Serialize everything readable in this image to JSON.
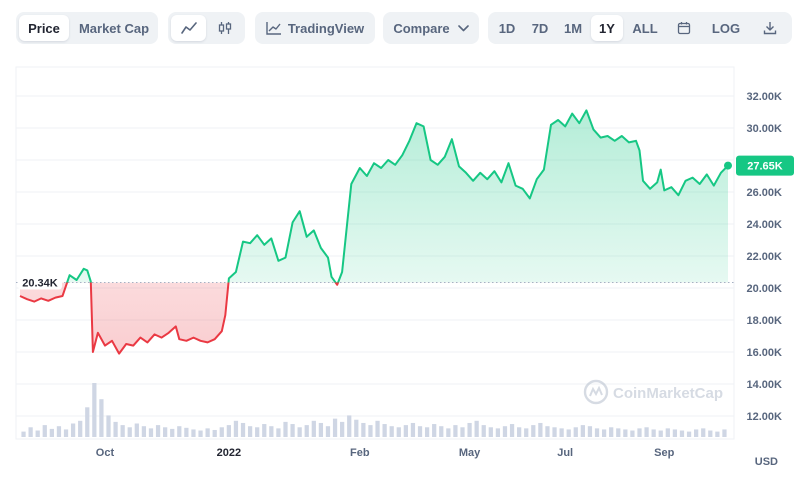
{
  "toolbar": {
    "mode_tabs": [
      {
        "label": "Price",
        "active": true
      },
      {
        "label": "Market Cap",
        "active": false
      }
    ],
    "chart_style": {
      "line_icon": "line-chart-icon",
      "candle_icon": "candlestick-icon",
      "active": "line"
    },
    "tradingview_label": "TradingView",
    "tradingview_icon": "tradingview-chart-icon",
    "compare_label": "Compare",
    "compare_icon": "chevron-down-icon",
    "ranges": [
      {
        "label": "1D",
        "active": false
      },
      {
        "label": "7D",
        "active": false
      },
      {
        "label": "1M",
        "active": false
      },
      {
        "label": "1Y",
        "active": true
      },
      {
        "label": "ALL",
        "active": false
      }
    ],
    "calendar_icon": "calendar-icon",
    "log_label": "LOG",
    "download_icon": "download-icon"
  },
  "watermark": "CoinMarketCap",
  "watermark_icon": "coinmarketcap-logo-icon",
  "colors": {
    "up": "#16c784",
    "down": "#ea3943",
    "grid": "#eff2f5",
    "baseline": "#a6b0c3",
    "volume": "#cfd6e4"
  },
  "chart_data": {
    "type": "area",
    "currency_label": "USD",
    "baseline": {
      "value": 20340,
      "label": "20.34K"
    },
    "current": {
      "value": 27650,
      "label": "27.65K"
    },
    "y_ticks": [
      {
        "value": 12000,
        "label": "12.00K"
      },
      {
        "value": 14000,
        "label": "14.00K"
      },
      {
        "value": 16000,
        "label": "16.00K"
      },
      {
        "value": 18000,
        "label": "18.00K"
      },
      {
        "value": 20000,
        "label": "20.00K"
      },
      {
        "value": 22000,
        "label": "22.00K"
      },
      {
        "value": 24000,
        "label": "24.00K"
      },
      {
        "value": 26000,
        "label": "26.00K"
      },
      {
        "value": 28000,
        "label": "28.00K"
      },
      {
        "value": 30000,
        "label": "30.00K"
      },
      {
        "value": 32000,
        "label": "32.00K"
      }
    ],
    "ylim": [
      11000,
      33500
    ],
    "x_ticks": [
      {
        "t": 0.12,
        "label": "Oct",
        "bold": false
      },
      {
        "t": 0.295,
        "label": "2022",
        "bold": true
      },
      {
        "t": 0.48,
        "label": "Feb",
        "bold": false
      },
      {
        "t": 0.635,
        "label": "May",
        "bold": false
      },
      {
        "t": 0.77,
        "label": "Jul",
        "bold": false
      },
      {
        "t": 0.91,
        "label": "Sep",
        "bold": false
      }
    ],
    "price_series": [
      {
        "t": 0.0,
        "v": 19500
      },
      {
        "t": 0.01,
        "v": 19300
      },
      {
        "t": 0.02,
        "v": 19150
      },
      {
        "t": 0.03,
        "v": 19350
      },
      {
        "t": 0.04,
        "v": 19200
      },
      {
        "t": 0.05,
        "v": 19400
      },
      {
        "t": 0.06,
        "v": 19500
      },
      {
        "t": 0.07,
        "v": 20800
      },
      {
        "t": 0.08,
        "v": 20500
      },
      {
        "t": 0.09,
        "v": 21200
      },
      {
        "t": 0.095,
        "v": 21100
      },
      {
        "t": 0.1,
        "v": 20400
      },
      {
        "t": 0.103,
        "v": 16000
      },
      {
        "t": 0.11,
        "v": 17200
      },
      {
        "t": 0.12,
        "v": 16400
      },
      {
        "t": 0.13,
        "v": 16700
      },
      {
        "t": 0.14,
        "v": 15900
      },
      {
        "t": 0.15,
        "v": 16500
      },
      {
        "t": 0.16,
        "v": 16400
      },
      {
        "t": 0.17,
        "v": 16900
      },
      {
        "t": 0.18,
        "v": 16600
      },
      {
        "t": 0.19,
        "v": 17100
      },
      {
        "t": 0.2,
        "v": 16900
      },
      {
        "t": 0.21,
        "v": 17200
      },
      {
        "t": 0.22,
        "v": 17600
      },
      {
        "t": 0.225,
        "v": 16800
      },
      {
        "t": 0.235,
        "v": 16700
      },
      {
        "t": 0.245,
        "v": 16900
      },
      {
        "t": 0.255,
        "v": 16700
      },
      {
        "t": 0.265,
        "v": 16600
      },
      {
        "t": 0.275,
        "v": 16800
      },
      {
        "t": 0.285,
        "v": 17300
      },
      {
        "t": 0.29,
        "v": 18300
      },
      {
        "t": 0.295,
        "v": 20600
      },
      {
        "t": 0.305,
        "v": 21000
      },
      {
        "t": 0.315,
        "v": 22900
      },
      {
        "t": 0.325,
        "v": 22800
      },
      {
        "t": 0.335,
        "v": 23300
      },
      {
        "t": 0.345,
        "v": 22700
      },
      {
        "t": 0.355,
        "v": 23100
      },
      {
        "t": 0.365,
        "v": 21700
      },
      {
        "t": 0.375,
        "v": 21900
      },
      {
        "t": 0.385,
        "v": 24100
      },
      {
        "t": 0.395,
        "v": 24800
      },
      {
        "t": 0.405,
        "v": 23200
      },
      {
        "t": 0.415,
        "v": 23600
      },
      {
        "t": 0.425,
        "v": 22500
      },
      {
        "t": 0.435,
        "v": 21900
      },
      {
        "t": 0.44,
        "v": 20700
      },
      {
        "t": 0.448,
        "v": 20200
      },
      {
        "t": 0.455,
        "v": 21000
      },
      {
        "t": 0.462,
        "v": 24000
      },
      {
        "t": 0.468,
        "v": 26500
      },
      {
        "t": 0.48,
        "v": 27500
      },
      {
        "t": 0.49,
        "v": 27000
      },
      {
        "t": 0.5,
        "v": 27800
      },
      {
        "t": 0.51,
        "v": 27500
      },
      {
        "t": 0.52,
        "v": 28000
      },
      {
        "t": 0.53,
        "v": 27700
      },
      {
        "t": 0.54,
        "v": 28300
      },
      {
        "t": 0.55,
        "v": 29200
      },
      {
        "t": 0.56,
        "v": 30300
      },
      {
        "t": 0.57,
        "v": 30100
      },
      {
        "t": 0.58,
        "v": 28000
      },
      {
        "t": 0.59,
        "v": 27700
      },
      {
        "t": 0.6,
        "v": 28200
      },
      {
        "t": 0.61,
        "v": 29300
      },
      {
        "t": 0.62,
        "v": 27600
      },
      {
        "t": 0.63,
        "v": 27200
      },
      {
        "t": 0.64,
        "v": 26700
      },
      {
        "t": 0.65,
        "v": 27200
      },
      {
        "t": 0.66,
        "v": 26800
      },
      {
        "t": 0.67,
        "v": 27300
      },
      {
        "t": 0.68,
        "v": 26600
      },
      {
        "t": 0.69,
        "v": 27800
      },
      {
        "t": 0.7,
        "v": 26400
      },
      {
        "t": 0.71,
        "v": 26200
      },
      {
        "t": 0.72,
        "v": 25600
      },
      {
        "t": 0.73,
        "v": 26800
      },
      {
        "t": 0.74,
        "v": 27400
      },
      {
        "t": 0.75,
        "v": 30200
      },
      {
        "t": 0.76,
        "v": 30500
      },
      {
        "t": 0.77,
        "v": 30100
      },
      {
        "t": 0.78,
        "v": 30900
      },
      {
        "t": 0.79,
        "v": 30300
      },
      {
        "t": 0.8,
        "v": 31100
      },
      {
        "t": 0.81,
        "v": 29900
      },
      {
        "t": 0.82,
        "v": 29400
      },
      {
        "t": 0.83,
        "v": 29500
      },
      {
        "t": 0.84,
        "v": 29200
      },
      {
        "t": 0.85,
        "v": 29500
      },
      {
        "t": 0.86,
        "v": 29100
      },
      {
        "t": 0.87,
        "v": 29200
      },
      {
        "t": 0.875,
        "v": 28600
      },
      {
        "t": 0.88,
        "v": 26700
      },
      {
        "t": 0.89,
        "v": 26200
      },
      {
        "t": 0.9,
        "v": 26600
      },
      {
        "t": 0.905,
        "v": 27400
      },
      {
        "t": 0.91,
        "v": 26100
      },
      {
        "t": 0.92,
        "v": 26300
      },
      {
        "t": 0.93,
        "v": 25800
      },
      {
        "t": 0.94,
        "v": 26700
      },
      {
        "t": 0.95,
        "v": 26900
      },
      {
        "t": 0.96,
        "v": 26500
      },
      {
        "t": 0.97,
        "v": 27100
      },
      {
        "t": 0.98,
        "v": 26400
      },
      {
        "t": 0.99,
        "v": 27200
      },
      {
        "t": 1.0,
        "v": 27650
      }
    ],
    "volume_series": [
      0.1,
      0.18,
      0.12,
      0.22,
      0.15,
      0.2,
      0.14,
      0.25,
      0.3,
      0.55,
      1.0,
      0.7,
      0.4,
      0.28,
      0.22,
      0.18,
      0.25,
      0.2,
      0.16,
      0.22,
      0.18,
      0.15,
      0.2,
      0.17,
      0.14,
      0.12,
      0.16,
      0.13,
      0.18,
      0.22,
      0.3,
      0.26,
      0.2,
      0.18,
      0.24,
      0.2,
      0.16,
      0.28,
      0.24,
      0.18,
      0.22,
      0.3,
      0.26,
      0.2,
      0.34,
      0.28,
      0.4,
      0.32,
      0.26,
      0.22,
      0.3,
      0.24,
      0.2,
      0.18,
      0.22,
      0.26,
      0.2,
      0.18,
      0.24,
      0.2,
      0.16,
      0.22,
      0.18,
      0.26,
      0.3,
      0.22,
      0.18,
      0.16,
      0.2,
      0.24,
      0.18,
      0.16,
      0.22,
      0.26,
      0.2,
      0.18,
      0.16,
      0.14,
      0.18,
      0.22,
      0.2,
      0.16,
      0.14,
      0.18,
      0.16,
      0.14,
      0.12,
      0.16,
      0.18,
      0.14,
      0.12,
      0.16,
      0.14,
      0.12,
      0.1,
      0.14,
      0.16,
      0.12,
      0.1,
      0.14
    ]
  }
}
